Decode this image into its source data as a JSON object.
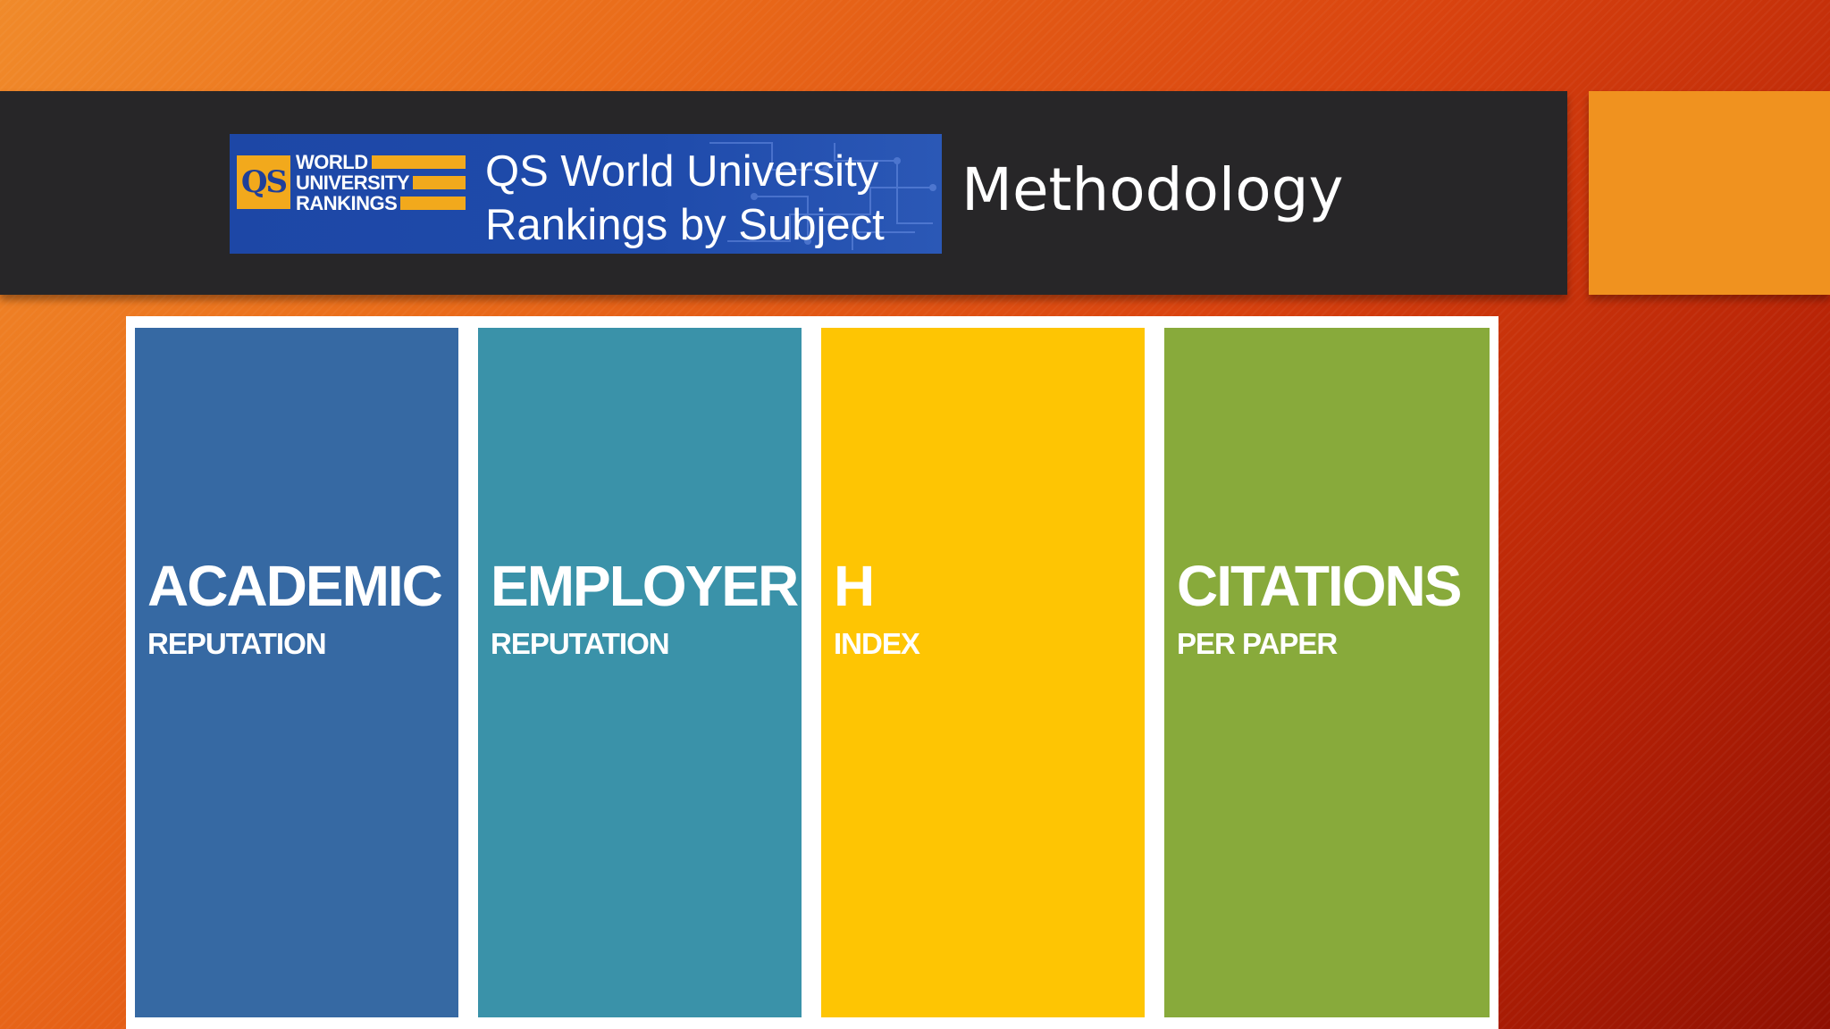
{
  "header": {
    "logo_badge": "QS",
    "logo_lines": [
      "WORLD",
      "UNIVERSITY",
      "RANKINGS"
    ],
    "banner_title_line1": "QS World University",
    "banner_title_line2": "Rankings by Subject",
    "title": "Methodology"
  },
  "colors": {
    "title_bar": "#272628",
    "accent": "#f0921f",
    "logo_blue": "#1d47a6",
    "logo_gold": "#f2a91c"
  },
  "pillars": [
    {
      "main": "ACADEMIC",
      "sub": "REPUTATION",
      "color": "#3669a3"
    },
    {
      "main": "EMPLOYER",
      "sub": "REPUTATION",
      "color": "#3a92a9"
    },
    {
      "main": "H",
      "sub": "INDEX",
      "color": "#fec503"
    },
    {
      "main": "CITATIONS",
      "sub": "PER PAPER",
      "color": "#88aa3b"
    }
  ]
}
